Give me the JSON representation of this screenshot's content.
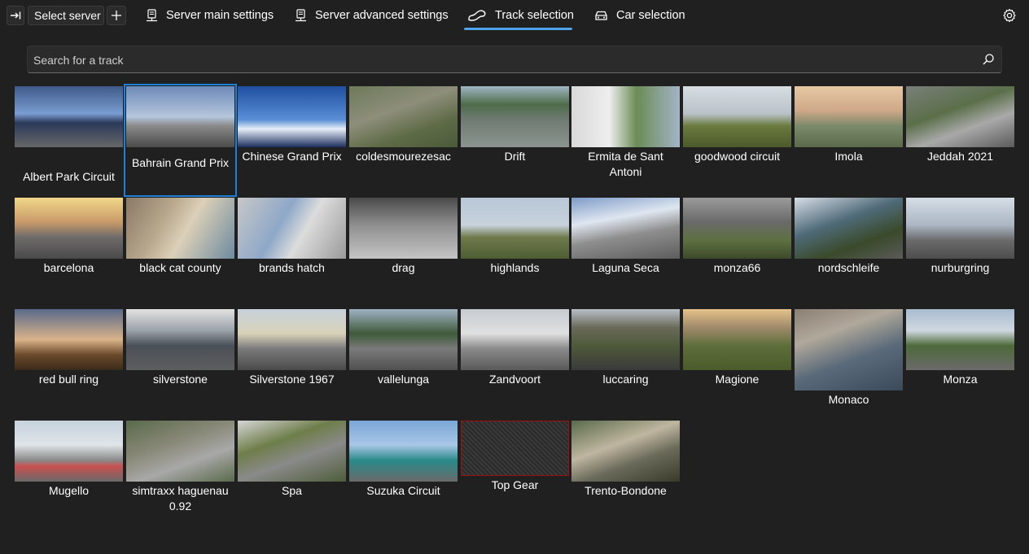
{
  "toolbar": {
    "select_server_label": "Select server",
    "tabs": [
      {
        "label": "Server main settings",
        "icon": "server-icon"
      },
      {
        "label": "Server advanced settings",
        "icon": "server-icon"
      },
      {
        "label": "Track selection",
        "icon": "track-icon",
        "active": true
      },
      {
        "label": "Car selection",
        "icon": "car-icon"
      }
    ]
  },
  "search": {
    "placeholder": "Search for a track"
  },
  "colors": {
    "accent": "#4ea3ea",
    "selection": "#1f7fd6",
    "background": "#202020"
  },
  "tracks": [
    {
      "name": "Albert Park Circuit"
    },
    {
      "name": "Bahrain Grand Prix",
      "selected": true
    },
    {
      "name": "Chinese Grand Prix"
    },
    {
      "name": "coldesmourezesac"
    },
    {
      "name": "Drift"
    },
    {
      "name": "Ermita de Sant Antoni"
    },
    {
      "name": "goodwood circuit"
    },
    {
      "name": "Imola"
    },
    {
      "name": "Jeddah 2021"
    },
    {
      "name": "barcelona"
    },
    {
      "name": "black cat county"
    },
    {
      "name": "brands hatch"
    },
    {
      "name": "drag"
    },
    {
      "name": "highlands"
    },
    {
      "name": "Laguna Seca"
    },
    {
      "name": "monza66"
    },
    {
      "name": "nordschleife"
    },
    {
      "name": "nurburgring"
    },
    {
      "name": "red bull ring"
    },
    {
      "name": "silverstone"
    },
    {
      "name": "Silverstone 1967"
    },
    {
      "name": "vallelunga"
    },
    {
      "name": "Zandvoort"
    },
    {
      "name": "luccaring"
    },
    {
      "name": "Magione"
    },
    {
      "name": "Monaco"
    },
    {
      "name": "Monza"
    },
    {
      "name": "Mugello"
    },
    {
      "name": "simtraxx haguenau 0.92"
    },
    {
      "name": "Spa"
    },
    {
      "name": "Suzuka Circuit"
    },
    {
      "name": "Top Gear"
    },
    {
      "name": "Trento-Bondone"
    }
  ]
}
